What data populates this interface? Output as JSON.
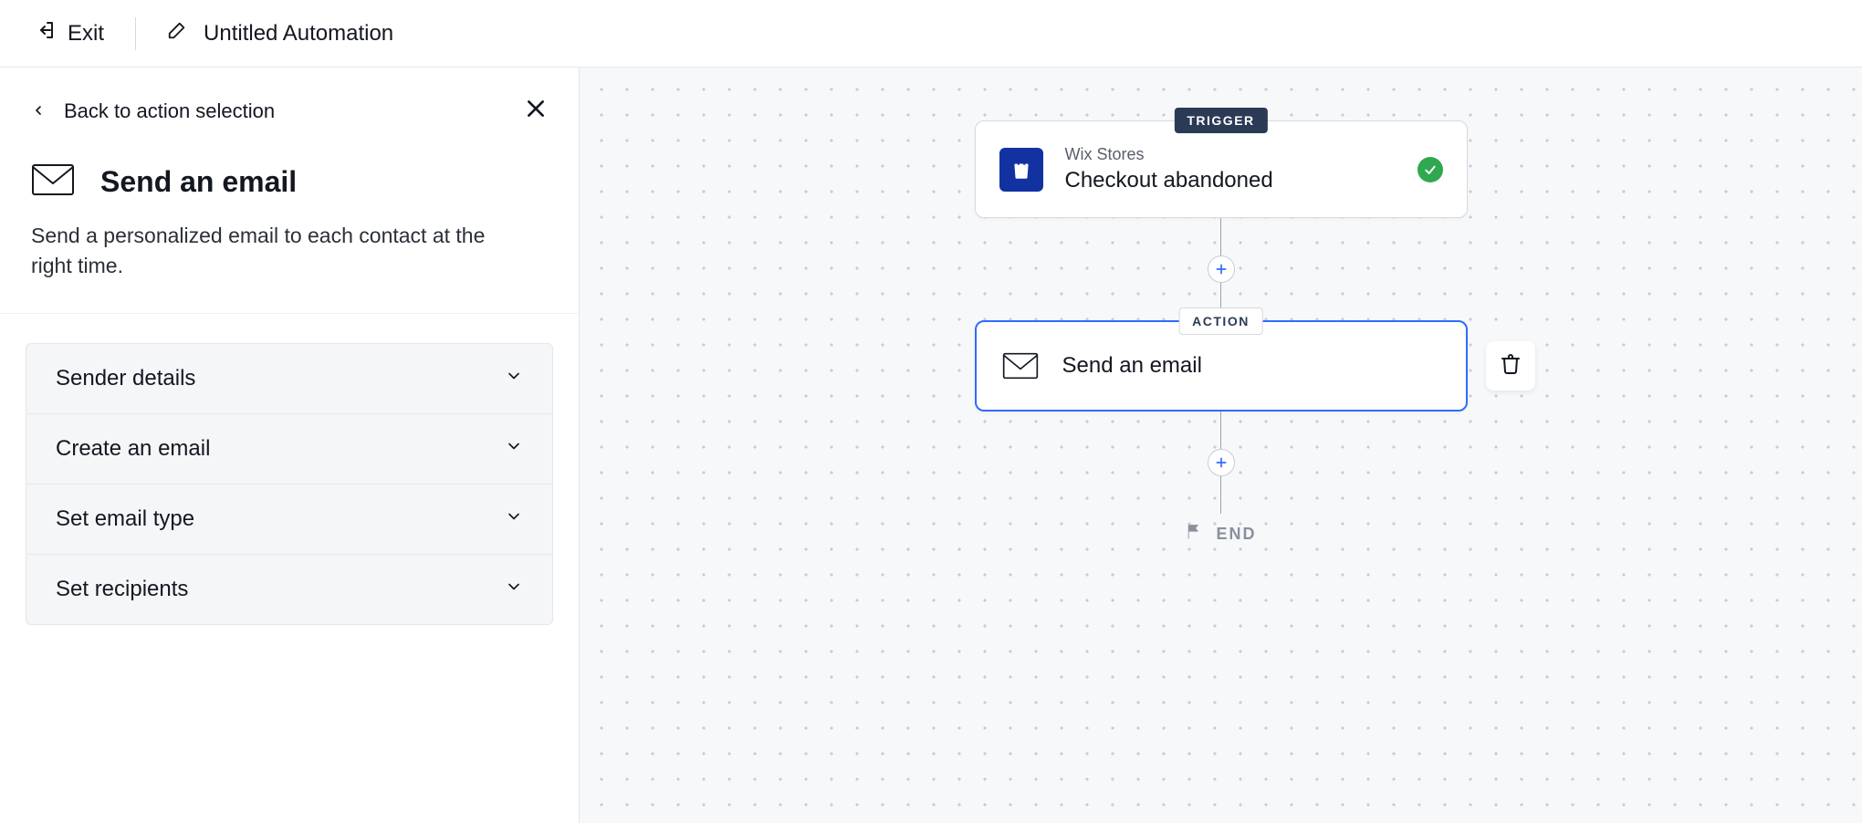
{
  "topbar": {
    "exit_label": "Exit",
    "title": "Untitled Automation"
  },
  "panel": {
    "back_label": "Back to action selection",
    "title": "Send an email",
    "description": "Send a personalized email to each contact at the right time.",
    "accordion": [
      {
        "label": "Sender details"
      },
      {
        "label": "Create an email"
      },
      {
        "label": "Set email type"
      },
      {
        "label": "Set recipients"
      }
    ]
  },
  "flow": {
    "trigger_badge": "TRIGGER",
    "action_badge": "ACTION",
    "trigger": {
      "app": "Wix Stores",
      "title": "Checkout abandoned"
    },
    "action": {
      "title": "Send an email"
    },
    "end_label": "END"
  }
}
